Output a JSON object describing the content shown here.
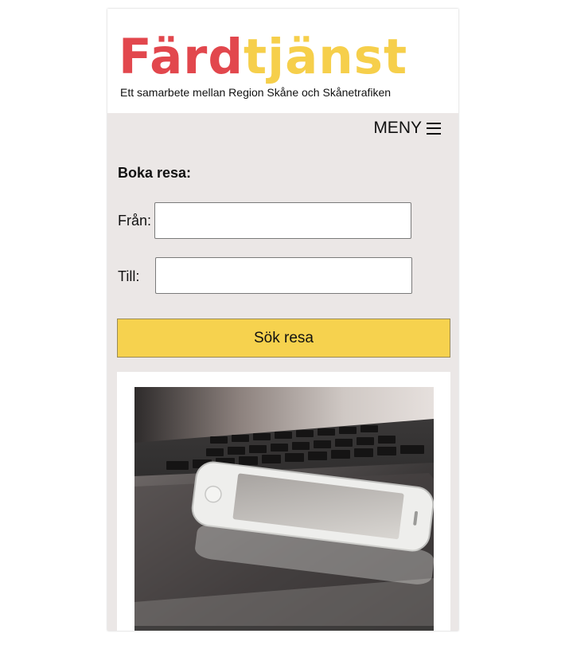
{
  "header": {
    "logo_part_a": "Färd",
    "logo_part_b": "tjänst",
    "tagline": "Ett samarbete mellan Region Skåne och Skånetrafiken"
  },
  "nav": {
    "menu_label": "MENY",
    "menu_icon": "hamburger-icon"
  },
  "booking": {
    "title": "Boka resa:",
    "from_label": "Från:",
    "from_value": "",
    "to_label": "Till:",
    "to_value": "",
    "search_button": "Sök resa"
  },
  "card": {
    "image": "phone-on-tablet-and-laptop-photo"
  },
  "colors": {
    "logo_red": "#e2474d",
    "logo_yellow": "#f6cf4b",
    "button_yellow": "#f6d24e",
    "page_background": "#ebe7e6"
  }
}
